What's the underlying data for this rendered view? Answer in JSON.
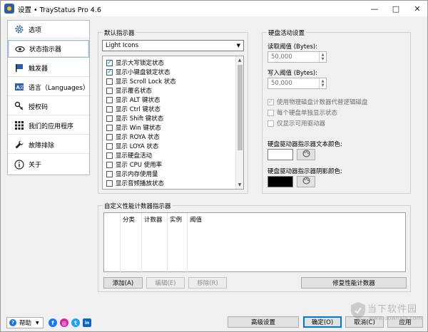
{
  "window": {
    "title": "设置 • TrayStatus Pro 4.6"
  },
  "sidebar": {
    "items": [
      {
        "label": "选项",
        "icon": "gear-icon"
      },
      {
        "label": "状态指示器",
        "icon": "eye-icon",
        "selected": true
      },
      {
        "label": "触发器",
        "icon": "flag-icon"
      },
      {
        "label": "语言（Languages）",
        "icon": "language-icon"
      },
      {
        "label": "授权码",
        "icon": "key-icon"
      },
      {
        "label": "我们的应用程序",
        "icon": "grid-icon"
      },
      {
        "label": "故障排除",
        "icon": "wrench-icon"
      },
      {
        "label": "关于",
        "icon": "info-icon"
      }
    ]
  },
  "default_indicators": {
    "title": "默认指示器",
    "theme": "Light Icons",
    "items": [
      {
        "label": "显示大写锁定状态",
        "checked": true
      },
      {
        "label": "显示小键盘锁定状态",
        "checked": true
      },
      {
        "label": "显示 Scroll Lock 状态",
        "checked": false
      },
      {
        "label": "显示覆名状态",
        "checked": false
      },
      {
        "label": "显示 ALT 键状态",
        "checked": false
      },
      {
        "label": "显示 Ctrl 键状态",
        "checked": false
      },
      {
        "label": "显示 Shift 键状态",
        "checked": false
      },
      {
        "label": "显示 Win 键状态",
        "checked": false
      },
      {
        "label": "显示 ROYA 状态",
        "checked": false
      },
      {
        "label": "显示 LOYA 状态",
        "checked": false
      },
      {
        "label": "显示硬盘活动",
        "checked": false
      },
      {
        "label": "显示 CPU 使用率",
        "checked": false
      },
      {
        "label": "显示内存使用量",
        "checked": false
      },
      {
        "label": "显示音频播放状态",
        "checked": false
      }
    ]
  },
  "disk_activity": {
    "title": "硬盘活动设置",
    "read_label": "读取阈值 (Bytes):",
    "read_value": "50,000",
    "write_label": "写入阈值 (Bytes):",
    "write_value": "50,000",
    "options": [
      {
        "label": "使用物理磁盘计数器代替逻辑磁盘",
        "checked": true
      },
      {
        "label": "每个硬盘单独显示状态",
        "checked": false
      },
      {
        "label": "仅显示可用驱动器",
        "checked": false
      }
    ],
    "text_color_label": "硬盘驱动器指示器文本颜色:",
    "text_color": "#ffffff",
    "shadow_color_label": "硬盘驱动器指示器阴影颜色:",
    "shadow_color": "#000000"
  },
  "custom_counters": {
    "title": "自定义性能计数器指示器",
    "columns": [
      "分类",
      "计数器",
      "实例",
      "阈值"
    ],
    "add_label": "添加(A)",
    "edit_label": "编辑(E)",
    "remove_label": "移除(R)",
    "restore_label": "修复性能计数器"
  },
  "footer": {
    "help_label": "帮助",
    "advanced_label": "高级设置",
    "ok_label": "确定(O)",
    "cancel_label": "取消(C)",
    "apply_label": "应用"
  },
  "social": [
    {
      "name": "facebook-icon",
      "glyph": "f",
      "color": "#1877f2"
    },
    {
      "name": "instagram-icon",
      "glyph": "◎",
      "color": "#d6249f"
    },
    {
      "name": "twitter-icon",
      "glyph": "t",
      "color": "#1da1f2"
    },
    {
      "name": "linkedin-icon",
      "glyph": "in",
      "color": "#0a66c2"
    }
  ],
  "watermark": {
    "text": "当下软件园",
    "sub": "www.downxia.com"
  }
}
